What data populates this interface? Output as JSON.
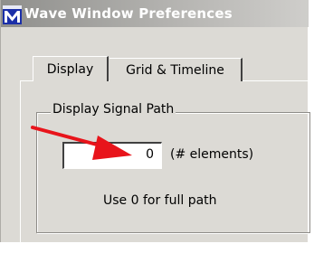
{
  "window": {
    "title": "Wave Window Preferences",
    "app_icon": "modelsim-m-icon"
  },
  "tabs": [
    {
      "label": "Display",
      "selected": true
    },
    {
      "label": "Grid & Timeline",
      "selected": false
    }
  ],
  "signal_path_group": {
    "legend": "Display Signal Path",
    "elements_input": {
      "value": "0"
    },
    "units_label": "(# elements)",
    "hint": "Use 0 for full path"
  },
  "annotation": {
    "icon": "red-arrow-icon",
    "color": "#e8141b"
  },
  "colors": {
    "dialog_bg": "#dcdad5",
    "title_text": "#ffffff",
    "icon_blue": "#1b2fa8"
  }
}
